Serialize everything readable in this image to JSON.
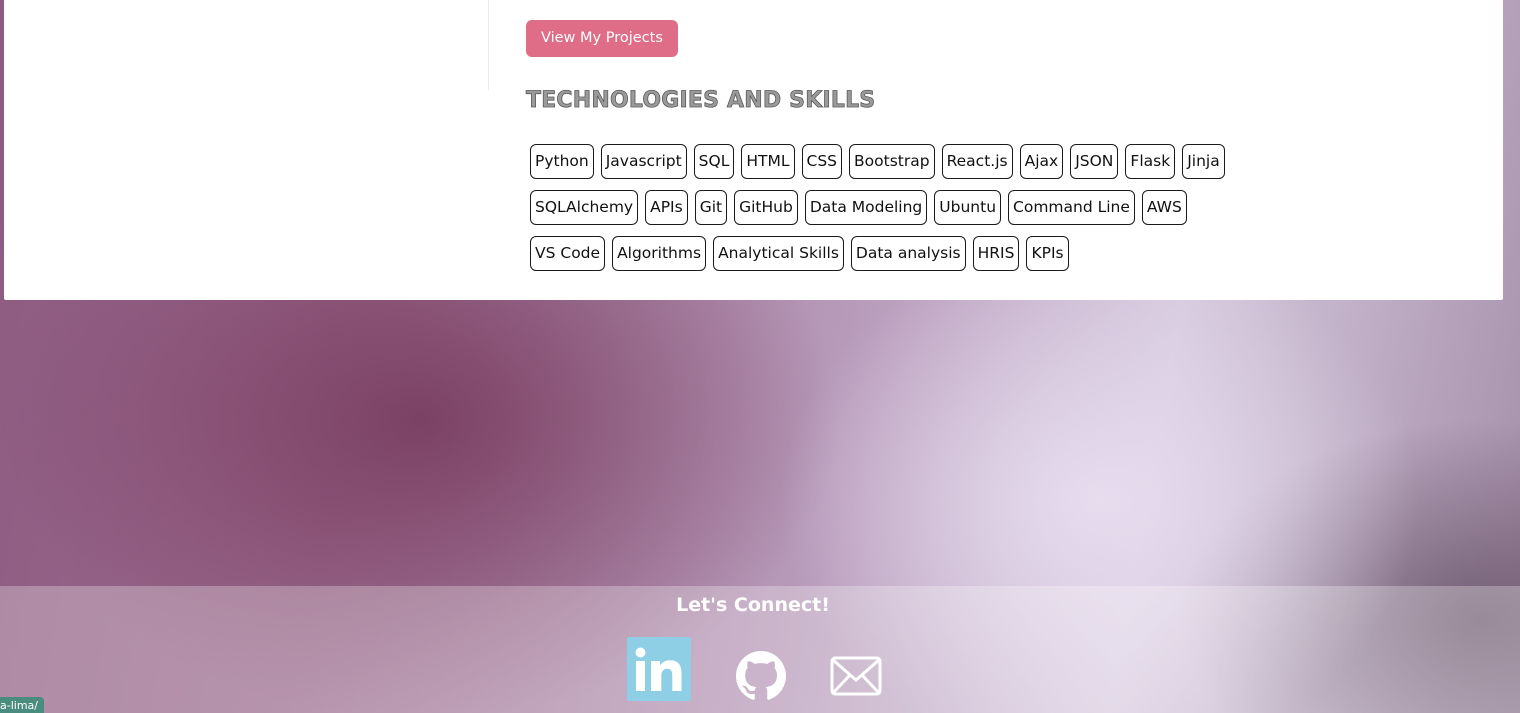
{
  "main": {
    "projects_button": "View My Projects",
    "skills_heading": "TECHNOLOGIES AND SKILLS",
    "skills": [
      "Python",
      "Javascript",
      "SQL",
      "HTML",
      "CSS",
      "Bootstrap",
      "React.js",
      "Ajax",
      "JSON",
      "Flask",
      "Jinja",
      "SQLAlchemy",
      "APIs",
      "Git",
      "GitHub",
      "Data Modeling",
      "Ubuntu",
      "Command Line",
      "AWS",
      "VS Code",
      "Algorithms",
      "Analytical Skills",
      "Data analysis",
      "HRIS",
      "KPIs"
    ]
  },
  "footer": {
    "title": "Let's Connect!",
    "links": [
      {
        "icon": "linkedin-icon"
      },
      {
        "icon": "github-icon"
      },
      {
        "icon": "mail-icon"
      }
    ]
  },
  "status_bar": {
    "url_fragment": "a-lima/"
  },
  "colors": {
    "accent_button": "#e06d87",
    "linkedin_tile": "#8ecfe6",
    "status_bar_bg": "#4a8c7e"
  }
}
